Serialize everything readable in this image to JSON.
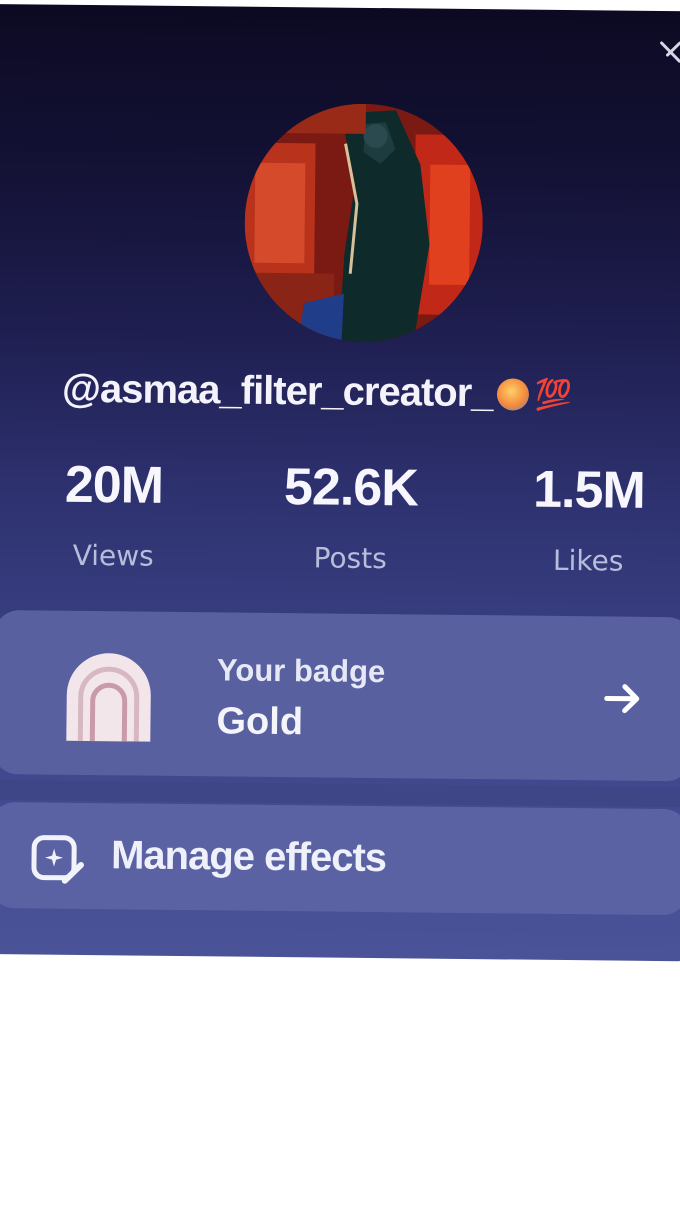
{
  "header": {
    "close_icon": "close-icon"
  },
  "profile": {
    "username": "@asmaa_filter_creator_",
    "emoji_1": "face-with-hearts-emoji",
    "emoji_2": "💯"
  },
  "stats": [
    {
      "value": "20M",
      "label": "Views"
    },
    {
      "value": "52.6K",
      "label": "Posts"
    },
    {
      "value": "1.5M",
      "label": "Likes"
    }
  ],
  "badge": {
    "title": "Your badge",
    "value": "Gold",
    "icon": "badge-arch-icon",
    "arrow_icon": "arrow-right-icon"
  },
  "effects": {
    "label": "Manage effects",
    "icon": "manage-effects-icon"
  },
  "colors": {
    "panel_top": "#0c0a22",
    "panel_bottom": "#4a5298",
    "card_bg": "#58609f",
    "text_primary": "#f4f4fb",
    "text_secondary": "#b9bddc"
  }
}
